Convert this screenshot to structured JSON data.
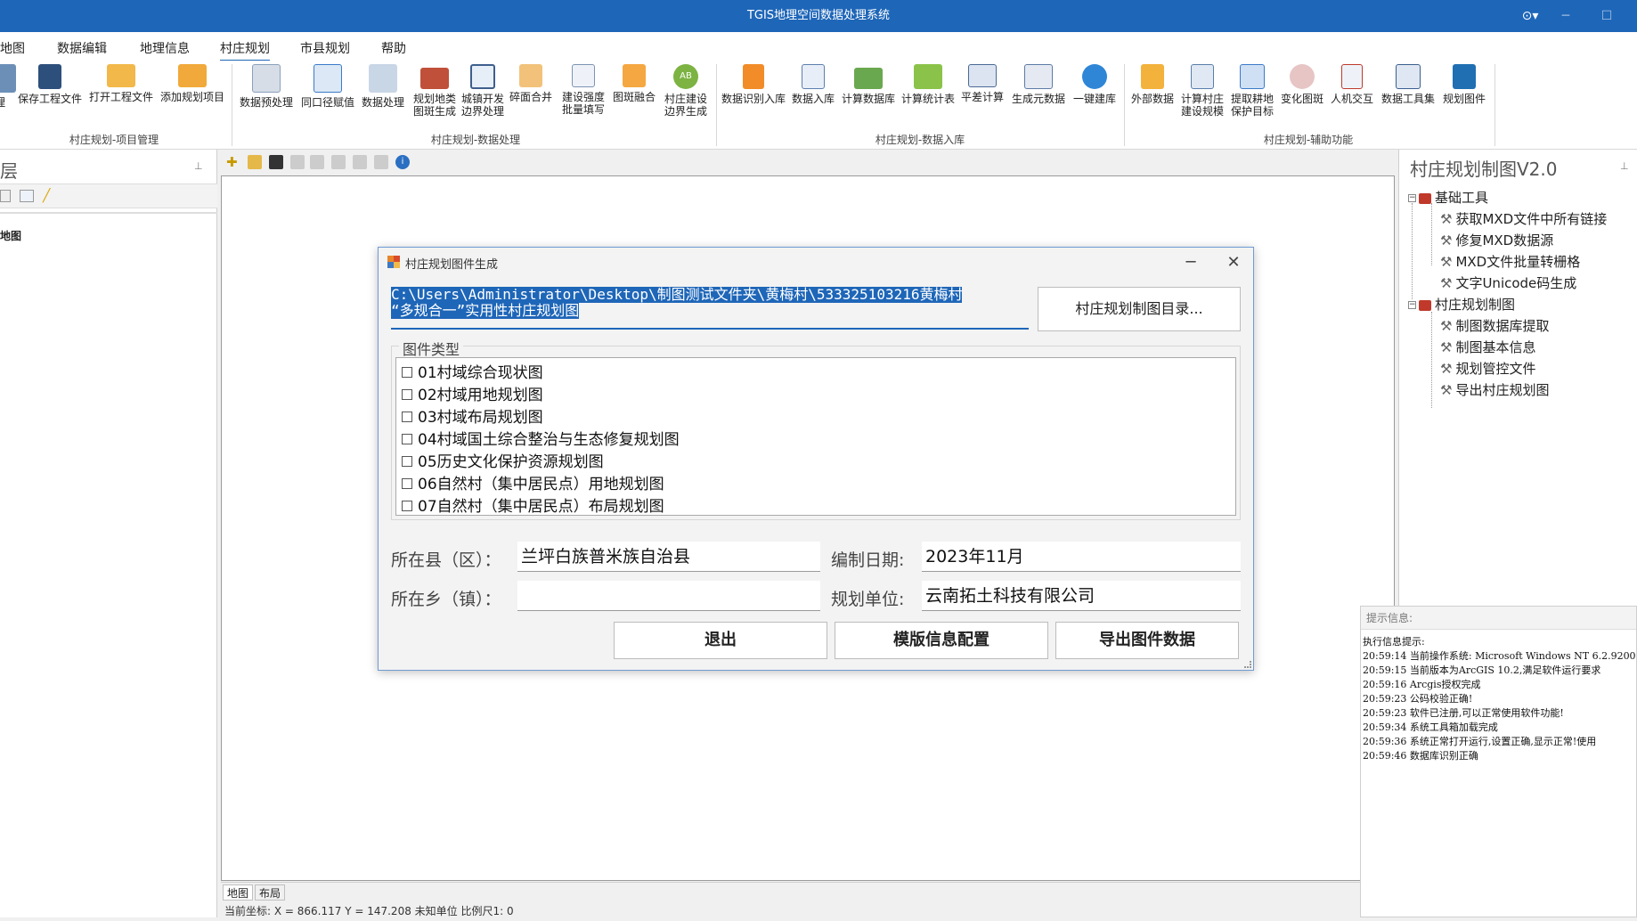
{
  "window": {
    "title": "TGIS地理空间数据处理系统"
  },
  "menu": {
    "items": [
      {
        "label": "地图"
      },
      {
        "label": "数据编辑"
      },
      {
        "label": "地理信息"
      },
      {
        "label": "村庄规划",
        "active": true
      },
      {
        "label": "市县规划"
      },
      {
        "label": "帮助"
      }
    ]
  },
  "ribbon": {
    "tools": [
      {
        "label": "理",
        "icon": "folder-icon"
      },
      {
        "label": "保存工程文件",
        "icon": "save-icon"
      },
      {
        "label": "打开工程文件",
        "icon": "folder-open-icon"
      },
      {
        "label": "添加规划项目",
        "icon": "folder-add-icon"
      },
      {
        "label": "数据预处理",
        "icon": "document-icon"
      },
      {
        "label": "同口径赋值",
        "icon": "assign-icon"
      },
      {
        "label": "数据处理",
        "icon": "tools-icon"
      },
      {
        "label": "规划地类\n图斑生成",
        "icon": "toolbox-icon"
      },
      {
        "label": "城镇开发\n边界处理",
        "icon": "boundary-icon"
      },
      {
        "label": "碎面合并",
        "icon": "merge-icon"
      },
      {
        "label": "建设强度\n批量填写",
        "icon": "batch-fill-icon"
      },
      {
        "label": "图斑融合",
        "icon": "dissolve-icon"
      },
      {
        "label": "村庄建设\n边界生成",
        "icon": "ab-icon"
      },
      {
        "label": "数据识别入库",
        "icon": "funnel-icon"
      },
      {
        "label": "数据入库",
        "icon": "list-icon"
      },
      {
        "label": "计算数据库",
        "icon": "calc-db-icon"
      },
      {
        "label": "计算统计表",
        "icon": "table-icon"
      },
      {
        "label": "平差计算",
        "icon": "sum-icon"
      },
      {
        "label": "生成元数据",
        "icon": "edit-doc-icon"
      },
      {
        "label": "一键建库",
        "icon": "play-icon"
      },
      {
        "label": "外部数据",
        "icon": "external-data-icon"
      },
      {
        "label": "计算村庄\n建设规模",
        "icon": "calc-scale-icon"
      },
      {
        "label": "提取耕地\n保护目标",
        "icon": "extract-icon"
      },
      {
        "label": "变化图斑",
        "icon": "change-map-icon"
      },
      {
        "label": "人机交互",
        "icon": "interaction-icon"
      },
      {
        "label": "数据工具集",
        "icon": "toolset-icon"
      },
      {
        "label": "规划图件",
        "icon": "planning-map-icon"
      }
    ],
    "groups": [
      {
        "label": "村庄规划-项目管理"
      },
      {
        "label": "村庄规划-数据处理"
      },
      {
        "label": "村庄规划-数据入库"
      },
      {
        "label": "村庄规划-辅助功能"
      }
    ]
  },
  "left_panel": {
    "title": "层",
    "layer_label": "地图"
  },
  "map": {
    "tabs": [
      {
        "label": "地图"
      },
      {
        "label": "布局"
      }
    ],
    "status": "当前坐标:  X = 866.117 Y = 147.208 未知单位  比例尺1: 0"
  },
  "right_panel": {
    "title": "村庄规划制图V2.0",
    "tree": [
      {
        "label": "基础工具",
        "children": [
          {
            "label": "获取MXD文件中所有链接"
          },
          {
            "label": "修复MXD数据源"
          },
          {
            "label": "MXD文件批量转栅格"
          },
          {
            "label": "文字Unicode码生成"
          }
        ]
      },
      {
        "label": "村庄规划制图",
        "children": [
          {
            "label": "制图数据库提取"
          },
          {
            "label": "制图基本信息"
          },
          {
            "label": "规划管控文件"
          },
          {
            "label": "导出村庄规划图"
          }
        ]
      }
    ]
  },
  "info_panel": {
    "title": "提示信息:",
    "lines": [
      "执行信息提示:",
      "20:59:14 当前操作系统: Microsoft Windows NT 6.2.9200",
      "20:59:15 当前版本为ArcGIS 10.2,满足软件运行要求",
      "20:59:16 Arcgis授权完成",
      "20:59:23 公码校验正确!",
      "20:59:23 软件已注册,可以正常使用软件功能!",
      "20:59:34 系统工具箱加载完成",
      "20:59:36 系统正常打开运行,设置正确,显示正常!使用",
      "20:59:46 数据库识别正确"
    ]
  },
  "dialog": {
    "title": "村庄规划图件生成",
    "minimize": "─",
    "close": "✕",
    "path_line1": "C:\\Users\\Administrator\\Desktop\\制图测试文件夹\\黄梅村\\533325103216黄梅村",
    "path_line2": "“多规合一”实用性村庄规划图",
    "browse_button": "村庄规划制图目录...",
    "map_type_group": "图件类型",
    "map_types": [
      {
        "label": "01村域综合现状图",
        "checked": false
      },
      {
        "label": "02村域用地规划图",
        "checked": false
      },
      {
        "label": "03村域布局规划图",
        "checked": false
      },
      {
        "label": "04村域国土综合整治与生态修复规划图",
        "checked": false
      },
      {
        "label": "05历史文化保护资源规划图",
        "checked": false
      },
      {
        "label": "06自然村（集中居民点）用地规划图",
        "checked": false
      },
      {
        "label": "07自然村（集中居民点）布局规划图",
        "checked": false
      }
    ],
    "county_label": "所在县（区）：",
    "county_value": "兰坪白族普米族自治县",
    "date_label": "编制日期:",
    "date_value": "2023年11月",
    "town_label": "所在乡（镇）：",
    "town_value": "",
    "unit_label": "规划单位:",
    "unit_value": "云南拓土科技有限公司",
    "exit_button": "退出",
    "template_button": "模版信息配置",
    "export_button": "导出图件数据"
  }
}
